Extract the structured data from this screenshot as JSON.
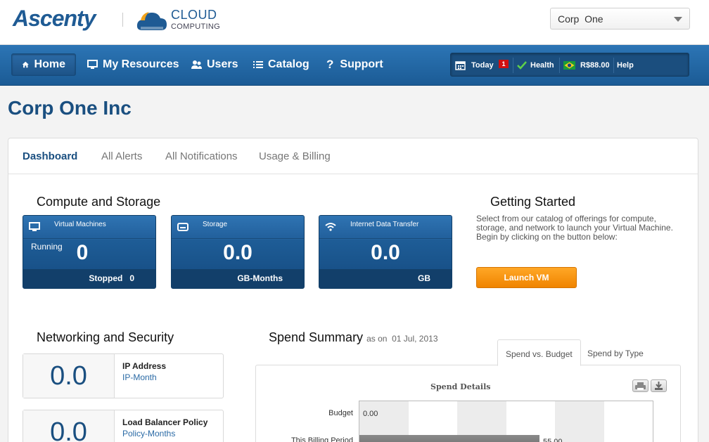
{
  "header": {
    "brand": "Ascenty",
    "cloud_line1": "CLOUD",
    "cloud_line2": "COMPUTING",
    "account_selected": "Corp  One"
  },
  "nav": {
    "home": "Home",
    "resources": "My Resources",
    "users": "Users",
    "catalog": "Catalog",
    "support": "Support"
  },
  "status": {
    "today": "Today",
    "today_count": "1",
    "health": "Health",
    "balance": "R$88.00",
    "help": "Help"
  },
  "page": {
    "title": "Corp One Inc"
  },
  "tabs": [
    "Dashboard",
    "All Alerts",
    "All Notifications",
    "Usage & Billing"
  ],
  "compute": {
    "title": "Compute and Storage",
    "tiles": [
      {
        "label": "Virtual Machines",
        "running_label": "Running",
        "value": "0",
        "foot": "Stopped   0",
        "icon": "monitor-icon"
      },
      {
        "label": "Storage",
        "value": "0.0",
        "foot": "GB-Months",
        "icon": "hard-drive-icon"
      },
      {
        "label": "Internet Data Transfer",
        "value": "0.0",
        "foot": "GB",
        "icon": "wifi-icon"
      }
    ]
  },
  "getting_started": {
    "title": "Getting Started",
    "text": "Select from our catalog of offerings for compute, storage, and network to launch your Virtual Machine. Begin by clicking on the button below:",
    "button": "Launch VM"
  },
  "networking": {
    "title": "Networking and Security",
    "items": [
      {
        "value": "0.0",
        "label": "IP Address",
        "unit": "IP-Month"
      },
      {
        "value": "0.0",
        "label": "Load Balancer Policy",
        "unit": "Policy-Months"
      }
    ]
  },
  "spend": {
    "title": "Spend Summary",
    "date": "as on  01 Jul, 2013",
    "tabs": [
      "Spend vs. Budget",
      "Spend by Type"
    ],
    "chart_title": "Spend Details",
    "icons": [
      "print-icon",
      "download-icon"
    ]
  },
  "chart_data": {
    "type": "bar",
    "title": "Spend Details",
    "orientation": "horizontal",
    "categories": [
      "Budget",
      "This Billing Period"
    ],
    "values": [
      0.0,
      55.0
    ],
    "data_labels": [
      "0.00",
      "55.00"
    ],
    "xlim": [
      0,
      90
    ],
    "grid": true
  }
}
